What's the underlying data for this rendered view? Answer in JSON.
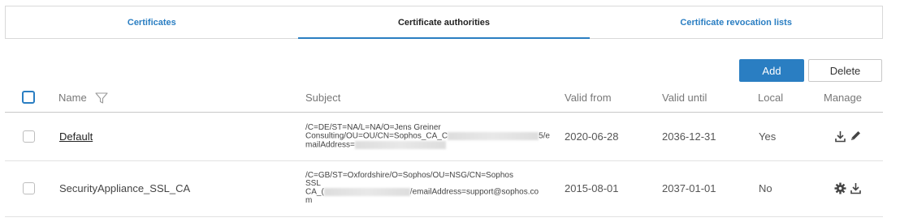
{
  "tabs": [
    {
      "label": "Certificates",
      "active": false
    },
    {
      "label": "Certificate authorities",
      "active": true
    },
    {
      "label": "Certificate revocation lists",
      "active": false
    }
  ],
  "toolbar": {
    "add_label": "Add",
    "delete_label": "Delete"
  },
  "table": {
    "headers": {
      "name": "Name",
      "subject": "Subject",
      "valid_from": "Valid from",
      "valid_until": "Valid until",
      "local": "Local",
      "manage": "Manage"
    },
    "rows": [
      {
        "name": "Default",
        "subject_line1": "/C=DE/ST=NA/L=NA/O=Jens Greiner",
        "subject_line2a": "Consulting/OU=OU/CN=Sophos_CA_C",
        "subject_line2b": "5/e",
        "subject_line3": "mailAddress=",
        "valid_from": "2020-06-28",
        "valid_until": "2036-12-31",
        "local": "Yes",
        "manage_icons": [
          "download-icon",
          "pencil-icon"
        ]
      },
      {
        "name": "SecurityAppliance_SSL_CA",
        "subject_line1": "/C=GB/ST=Oxfordshire/O=Sophos/OU=NSG/CN=Sophos",
        "subject_line2": "SSL",
        "subject_line3a": "CA_(",
        "subject_line3b": "/emailAddress=support@sophos.co",
        "subject_line4": "m",
        "valid_from": "2015-08-01",
        "valid_until": "2037-01-01",
        "local": "No",
        "manage_icons": [
          "gear-icon",
          "download-icon"
        ]
      }
    ]
  },
  "colors": {
    "accent": "#2a7ec2",
    "border": "#d9d9d9"
  }
}
